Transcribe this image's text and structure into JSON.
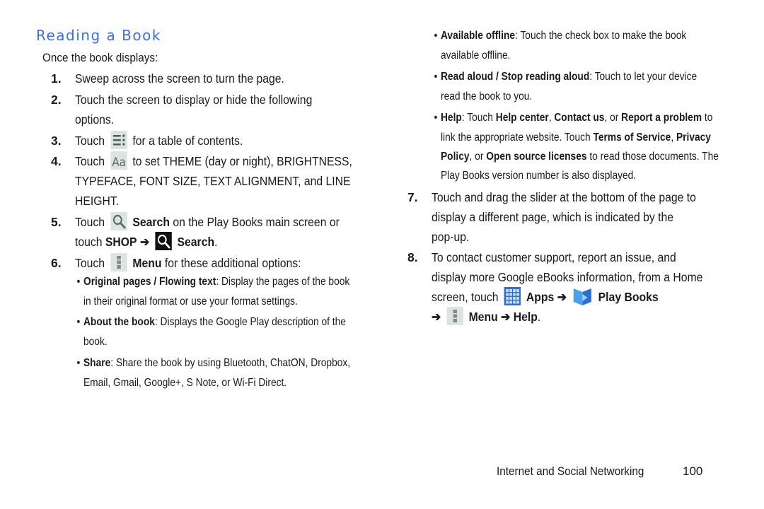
{
  "title": "Reading a Book",
  "intro": "Once the book displays:",
  "steps": {
    "s1": {
      "num": "1.",
      "text": "Sweep across the screen to turn the page."
    },
    "s2": {
      "num": "2.",
      "line1": "Touch the screen to display or hide the following",
      "line2": "options."
    },
    "s3": {
      "num": "3.",
      "pre": "Touch",
      "post": "for a table of contents.",
      "icon": "table-of-contents-icon"
    },
    "s4": {
      "num": "4.",
      "pre": "Touch",
      "post": "to set THEME (day or night), BRIGHTNESS,",
      "line2": "TYPEFACE, FONT SIZE, TEXT ALIGNMENT, and LINE",
      "line3": "HEIGHT.",
      "icon": "text-settings-icon"
    },
    "s5": {
      "num": "5.",
      "pre": "Touch",
      "bold1": "Search",
      "post": "on the Play Books main screen or",
      "line2_pre": "touch",
      "shop": "SHOP",
      "arrow": "➔",
      "bold2": "Search",
      "period": "."
    },
    "s6": {
      "num": "6.",
      "pre": "Touch",
      "bold": "Menu",
      "post": "for these additional options:"
    },
    "s7": {
      "num": "7.",
      "line1": "Touch and drag the slider at the bottom of the page to",
      "line2": "display a different page, which is indicated by the",
      "line3": "pop-up."
    },
    "s8": {
      "num": "8.",
      "line1": "To contact customer support, report an issue, and",
      "line2": "display more Google eBooks information, from a Home",
      "line3_pre": "screen, touch",
      "apps": "Apps",
      "arrow": "➔",
      "play_books": "Play Books",
      "menu": "Menu",
      "help": "Help",
      "period": "."
    }
  },
  "bullets": {
    "original": {
      "bold": "Original pages / Flowing text",
      "text": ": Display the pages of the book",
      "line2": "in their original format or use your format settings."
    },
    "about": {
      "bold": "About the book",
      "text": ": Displays the Google Play description of the",
      "line2": "book."
    },
    "share": {
      "bold": "Share",
      "text": ": Share the book by using Bluetooth, ChatON, Dropbox,",
      "line2": "Email, Gmail, Google+, S Note, or Wi-Fi Direct."
    },
    "offline": {
      "bold": "Available offline",
      "text": ": Touch the check box to make the book",
      "line2": "available offline."
    },
    "read_aloud": {
      "bold": "Read aloud / Stop reading aloud",
      "text": ": Touch to let your device",
      "line2": "read the book to you."
    },
    "help": {
      "bold": "Help",
      "t1": ": Touch ",
      "b1": "Help center",
      "t2": ", ",
      "b2": "Contact us",
      "t3": ", or ",
      "b3": "Report a problem",
      "t4": " to",
      "l2_t1": "link the appropriate website. Touch ",
      "l2_b1": "Terms of Service",
      "l2_t2": ", ",
      "l2_b2": "Privacy",
      "l3_b1": "Policy",
      "l3_t1": ", or ",
      "l3_b2": "Open source licenses",
      "l3_t2": " to read those documents. The",
      "line4": "Play Books version number is also displayed."
    }
  },
  "bullet_char": "•",
  "footer": {
    "section": "Internet and Social Networking",
    "page": "100"
  },
  "colors": {
    "title": "#3b6fd8",
    "icon_bg": "#dde3e2",
    "icon_fg": "#5a6b68",
    "apps_blue": "#2f6fd0"
  }
}
